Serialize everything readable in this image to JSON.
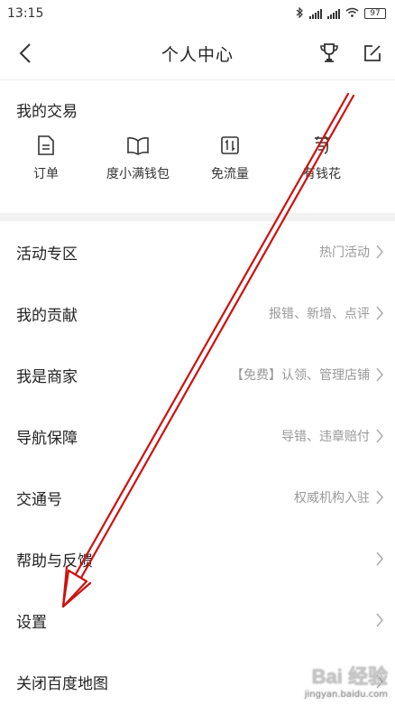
{
  "status_bar": {
    "time": "13:15",
    "battery": "97"
  },
  "nav": {
    "title": "个人中心"
  },
  "trade": {
    "title": "我的交易",
    "items": [
      {
        "label": "订单",
        "icon": "document-icon"
      },
      {
        "label": "度小满钱包",
        "icon": "book-icon"
      },
      {
        "label": "免流量",
        "icon": "data-transfer-icon"
      },
      {
        "label": "有钱花",
        "icon": "money-flower-icon"
      }
    ]
  },
  "menu": [
    {
      "label": "活动专区",
      "hint": "热门活动"
    },
    {
      "label": "我的贡献",
      "hint": "报错、新增、点评"
    },
    {
      "label": "我是商家",
      "hint": "【免费】认领、管理店铺"
    },
    {
      "label": "导航保障",
      "hint": "导错、违章赔付"
    },
    {
      "label": "交通号",
      "hint": "权威机构入驻"
    },
    {
      "label": "帮助与反馈",
      "hint": ""
    },
    {
      "label": "设置",
      "hint": ""
    },
    {
      "label": "关闭百度地图",
      "hint": ""
    }
  ],
  "watermark": {
    "logo": "Bai 经验",
    "url": "jingyan.baidu.com"
  },
  "colors": {
    "annotation": "#cc1111",
    "hint": "#999999",
    "divider": "#f2f2f2"
  }
}
